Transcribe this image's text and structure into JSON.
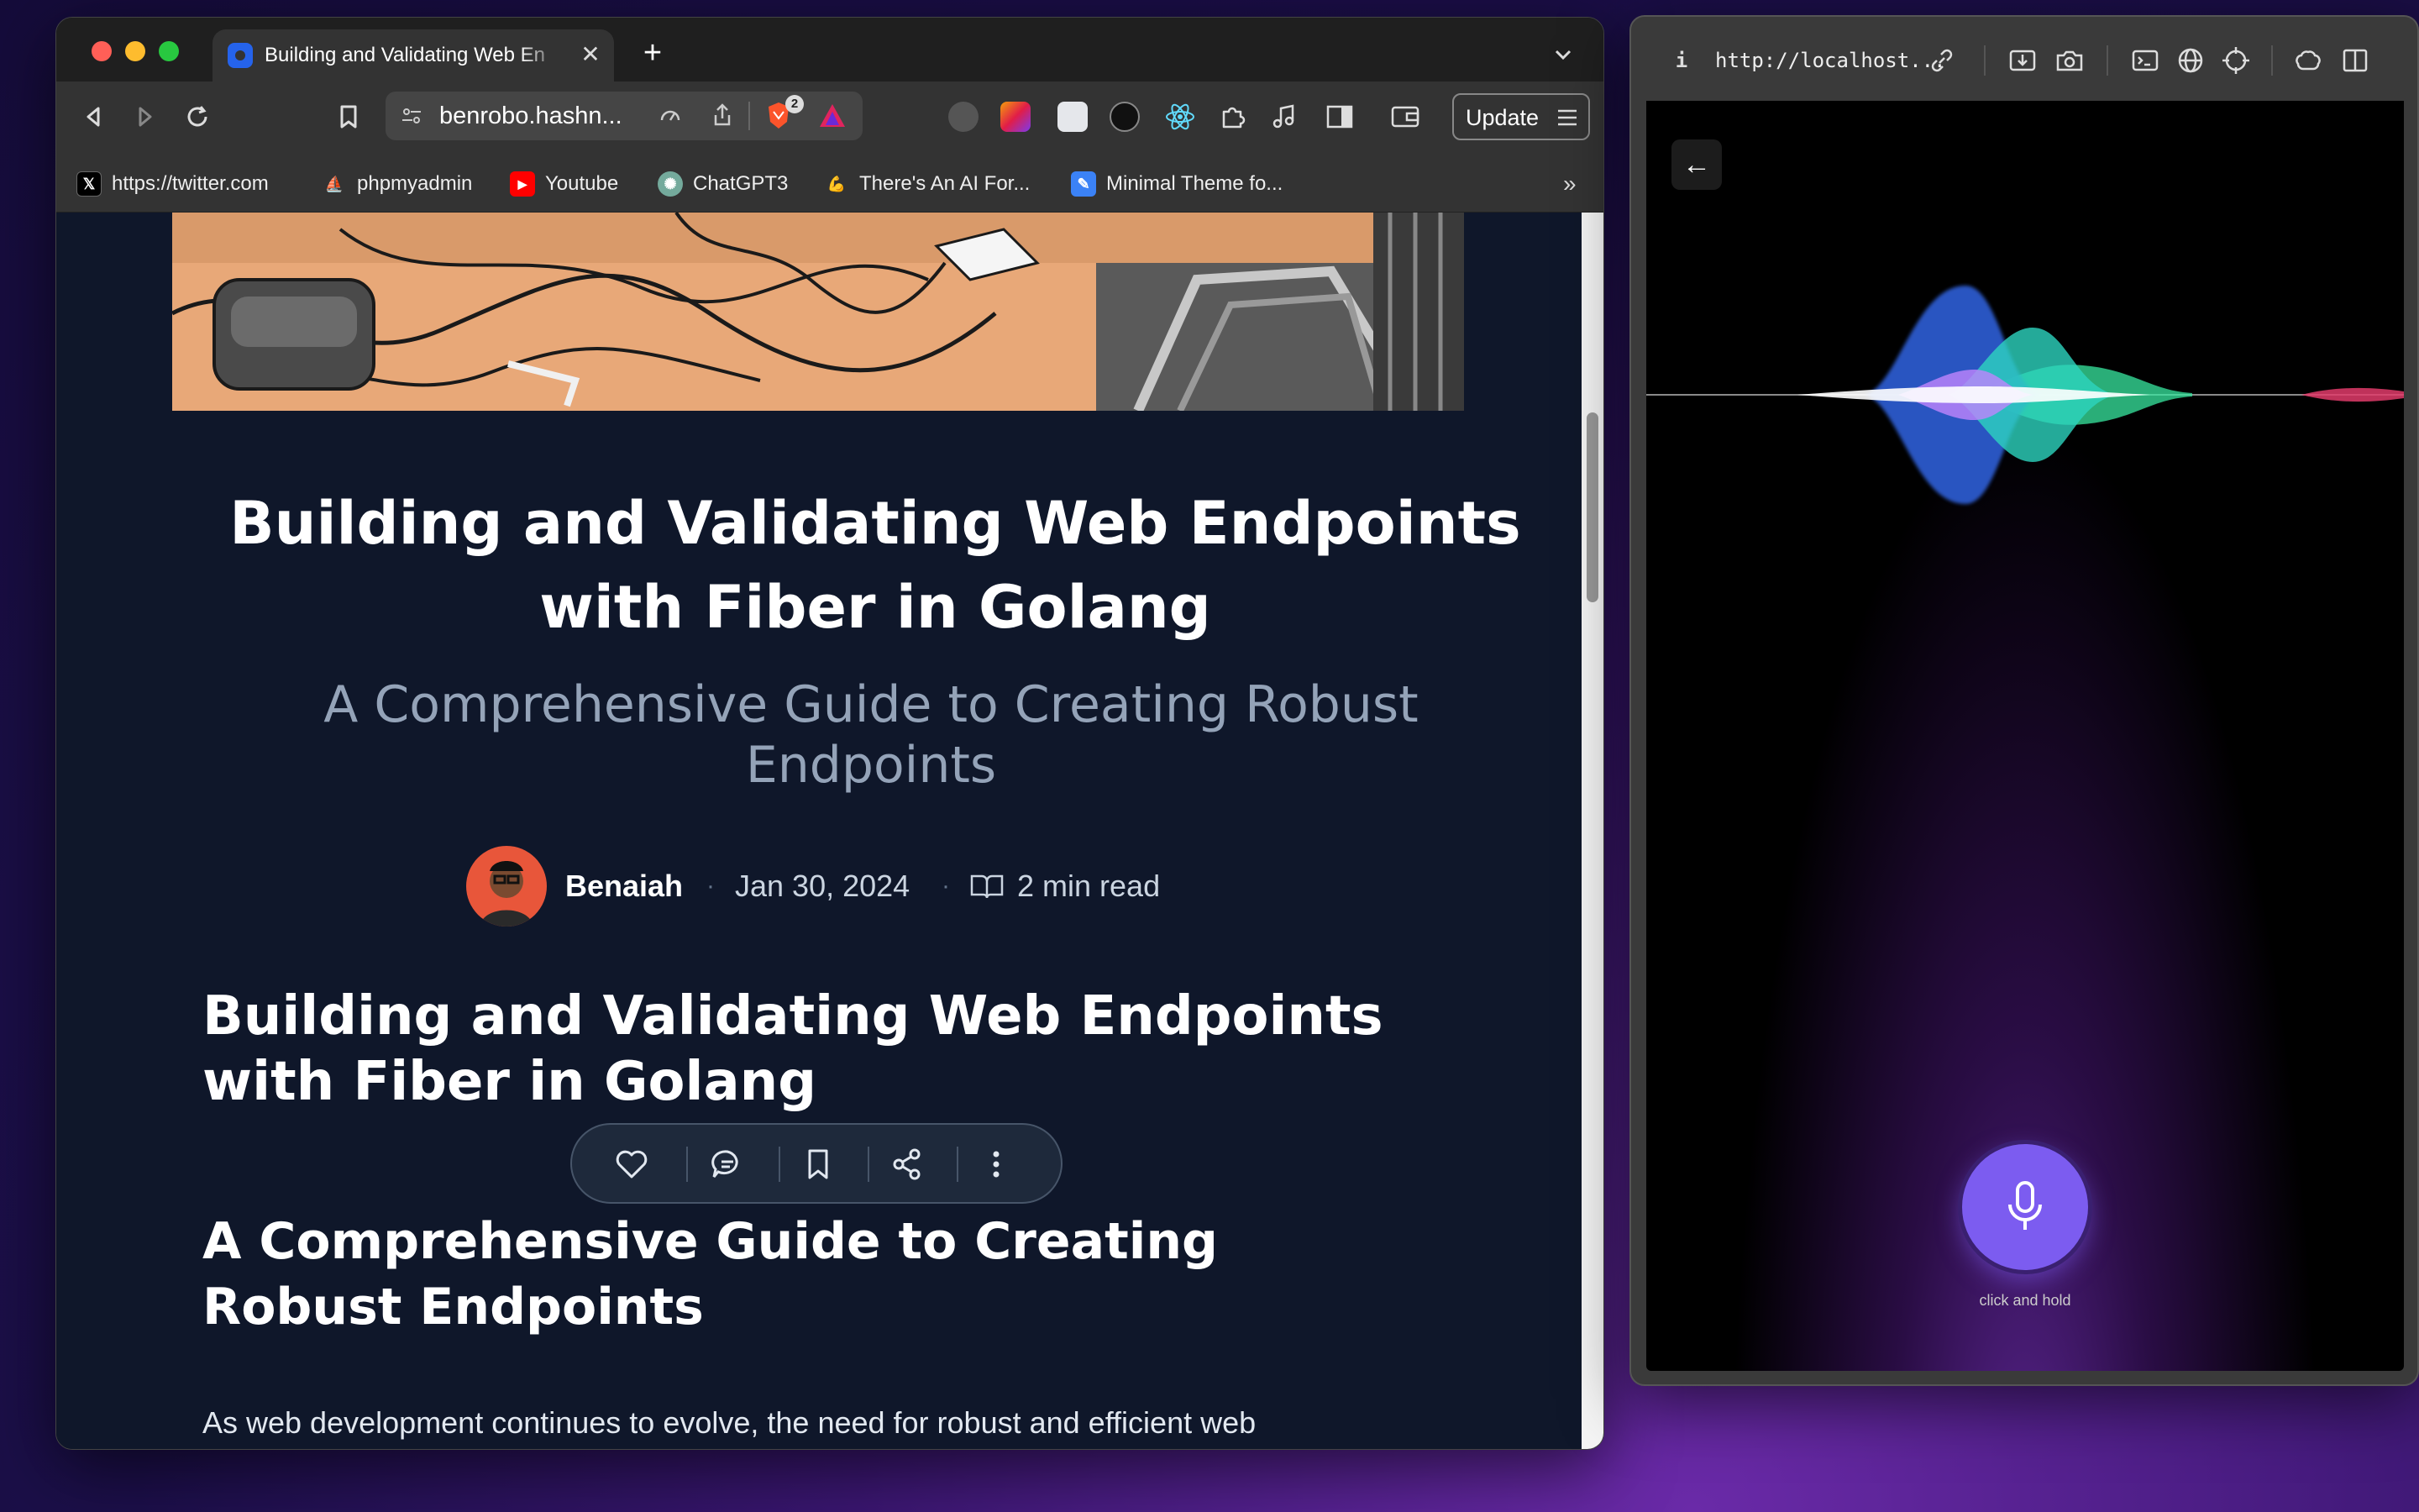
{
  "browser": {
    "tab": {
      "title": "Building and Validating Web En"
    },
    "url": "benrobo.hashn...",
    "brave_badge": "2",
    "update_label": "Update",
    "bookmarks": [
      {
        "label": "https://twitter.com",
        "icon": "x-logo-icon"
      },
      {
        "label": "phpmyadmin",
        "icon": "phpmyadmin-icon"
      },
      {
        "label": "Youtube",
        "icon": "youtube-icon"
      },
      {
        "label": "ChatGPT3",
        "icon": "chatgpt-icon"
      },
      {
        "label": "There's An AI For...",
        "icon": "ai-tool-icon"
      },
      {
        "label": "Minimal Theme fo...",
        "icon": "theme-icon"
      }
    ],
    "more_bookmarks": "»"
  },
  "article": {
    "title": "Building and Validating Web Endpoints with Fiber in Golang",
    "subtitle": "A Comprehensive Guide to Creating Robust Endpoints",
    "author": "Benaiah",
    "date": "Jan 30, 2024",
    "read_time": "2 min read",
    "h1": "Building and Validating Web Endpoints with Fiber in Golang",
    "h2": "A Comprehensive Guide to Creating Robust Endpoints",
    "body": "As web development continues to evolve, the need for robust and efficient web"
  },
  "device": {
    "url": "http://localhost...",
    "back_arrow": "←",
    "mic_hint": "click and hold"
  },
  "colors": {
    "accent": "#7c5cf0",
    "page_bg": "#0f172a",
    "wave_blue": "#2d5fd6",
    "wave_green": "#38e8a0",
    "wave_pink": "#e03b6a"
  }
}
